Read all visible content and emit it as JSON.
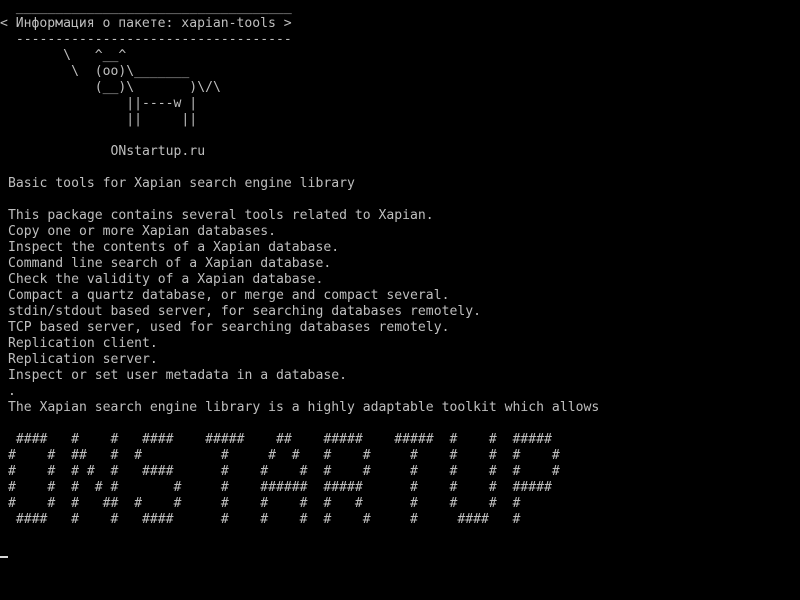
{
  "terminal": {
    "cowsay": {
      "top_border": " ___________________________________",
      "title": "< Информация о пакете: xapian-tools >",
      "bottom_border": " -----------------------------------",
      "cow": [
        "       \\   ^__^",
        "        \\  (oo)\\_______",
        "           (__)\\       )\\/\\",
        "               ||----w |",
        "               ||     ||"
      ],
      "site": "             ONstartup.ru"
    },
    "summary": "Basic tools for Xapian search engine library",
    "description": [
      "This package contains several tools related to Xapian.",
      "Copy one or more Xapian databases.",
      "Inspect the contents of a Xapian database.",
      "Command line search of a Xapian database.",
      "Check the validity of a Xapian database.",
      "Compact a quartz database, or merge and compact several.",
      "stdin/stdout based server, for searching databases remotely.",
      "TCP based server, used for searching databases remotely.",
      "Replication client.",
      "Replication server.",
      "Inspect or set user metadata in a database.",
      ".",
      "The Xapian search engine library is a highly adaptable toolkit which allows"
    ],
    "banner": [
      " ####   #    #   ####    #####    ##    #####    #####  #    #  #####",
      "#    #  ##   #  #          #     #  #   #    #     #    #    #  #    #",
      "#    #  # #  #   ####      #    #    #  #    #     #    #    #  #    #",
      "#    #  #  # #       #     #    ######  #####      #    #    #  #####",
      "#    #  #   ##  #    #     #    #    #  #   #      #    #    #  #",
      " ####   #    #   ####      #    #    #  #    #     #     ####   #"
    ]
  }
}
